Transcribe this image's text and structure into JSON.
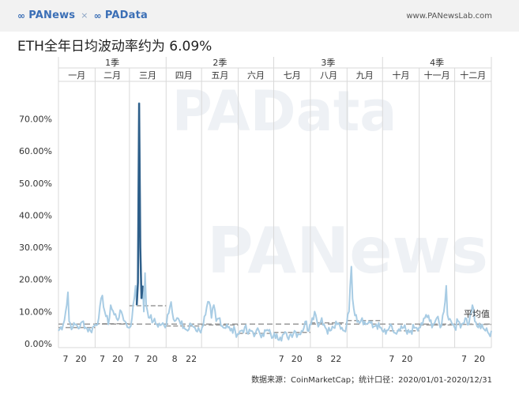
{
  "header": {
    "brand_left": "PANews",
    "brand_sep": "×",
    "brand_right": "PAData",
    "site": "www.PANewsLab.com"
  },
  "title": "ETH全年日均波动率约为 6.09%",
  "source": "数据来源：CoinMarketCap；统计口径：2020/01/01-2020/12/31",
  "watermarks": [
    "PAData",
    "PANews"
  ],
  "colors": {
    "series": "#a8cce4",
    "series_peak": "#2e5f8a",
    "avg_line": "#999999",
    "grid": "#d9d9d9"
  },
  "chart_data": {
    "type": "line",
    "quarters": [
      "1季",
      "2季",
      "3季",
      "4季"
    ],
    "months": [
      "一月",
      "二月",
      "三月",
      "四月",
      "五月",
      "六月",
      "七月",
      "八月",
      "九月",
      "十月",
      "十一月",
      "十二月"
    ],
    "month_days": [
      31,
      29,
      31,
      30,
      31,
      30,
      31,
      31,
      30,
      31,
      30,
      31
    ],
    "x_ticks": [
      {
        "label": "7",
        "day": 7
      },
      {
        "label": "20",
        "day": 20
      },
      {
        "label": "7",
        "day": 38
      },
      {
        "label": "20",
        "day": 51
      },
      {
        "label": "7",
        "day": 67
      },
      {
        "label": "20",
        "day": 80
      },
      {
        "label": "8",
        "day": 99
      },
      {
        "label": "22",
        "day": 113
      },
      {
        "label": "7",
        "day": 189
      },
      {
        "label": "20",
        "day": 202
      },
      {
        "label": "8",
        "day": 221
      },
      {
        "label": "22",
        "day": 235
      },
      {
        "label": "7",
        "day": 282
      },
      {
        "label": "20",
        "day": 295
      },
      {
        "label": "7",
        "day": 343
      },
      {
        "label": "20",
        "day": 356
      }
    ],
    "y_ticks": [
      "0.00%",
      "10.00%",
      "20.00%",
      "30.00%",
      "40.00%",
      "50.00%",
      "60.00%",
      "70.00%"
    ],
    "ylim": [
      0,
      0.78
    ],
    "y_tick_values": [
      0,
      0.1,
      0.2,
      0.3,
      0.4,
      0.5,
      0.6,
      0.7
    ],
    "avg_label": "平均值",
    "annual_average": 0.0609,
    "monthly_averages": [
      0.05,
      0.062,
      0.118,
      0.055,
      0.058,
      0.032,
      0.035,
      0.065,
      0.072,
      0.04,
      0.058,
      0.06
    ],
    "anchors": [
      [
        1,
        0.04
      ],
      [
        5,
        0.06
      ],
      [
        8,
        0.12
      ],
      [
        9,
        0.16
      ],
      [
        10,
        0.07
      ],
      [
        13,
        0.05
      ],
      [
        16,
        0.06
      ],
      [
        19,
        0.05
      ],
      [
        22,
        0.07
      ],
      [
        24,
        0.05
      ],
      [
        28,
        0.04
      ],
      [
        32,
        0.06
      ],
      [
        35,
        0.08
      ],
      [
        38,
        0.15
      ],
      [
        40,
        0.1
      ],
      [
        43,
        0.06
      ],
      [
        45,
        0.12
      ],
      [
        48,
        0.09
      ],
      [
        52,
        0.08
      ],
      [
        54,
        0.1
      ],
      [
        57,
        0.07
      ],
      [
        60,
        0.05
      ],
      [
        61,
        0.05
      ],
      [
        63,
        0.08
      ],
      [
        66,
        0.18
      ],
      [
        67,
        0.12
      ],
      [
        68,
        0.19
      ],
      [
        69,
        0.75
      ],
      [
        70,
        0.3
      ],
      [
        71,
        0.14
      ],
      [
        72,
        0.18
      ],
      [
        73,
        0.1
      ],
      [
        74,
        0.22
      ],
      [
        75,
        0.12
      ],
      [
        78,
        0.08
      ],
      [
        81,
        0.07
      ],
      [
        84,
        0.06
      ],
      [
        88,
        0.06
      ],
      [
        91,
        0.05
      ],
      [
        93,
        0.09
      ],
      [
        96,
        0.13
      ],
      [
        99,
        0.07
      ],
      [
        101,
        0.08
      ],
      [
        104,
        0.06
      ],
      [
        107,
        0.05
      ],
      [
        110,
        0.04
      ],
      [
        113,
        0.06
      ],
      [
        116,
        0.05
      ],
      [
        120,
        0.04
      ],
      [
        122,
        0.05
      ],
      [
        125,
        0.09
      ],
      [
        128,
        0.13
      ],
      [
        130,
        0.08
      ],
      [
        132,
        0.12
      ],
      [
        134,
        0.07
      ],
      [
        137,
        0.08
      ],
      [
        140,
        0.05
      ],
      [
        143,
        0.06
      ],
      [
        146,
        0.04
      ],
      [
        150,
        0.04
      ],
      [
        152,
        0.03
      ],
      [
        155,
        0.04
      ],
      [
        158,
        0.05
      ],
      [
        161,
        0.03
      ],
      [
        164,
        0.04
      ],
      [
        167,
        0.03
      ],
      [
        170,
        0.04
      ],
      [
        173,
        0.03
      ],
      [
        176,
        0.04
      ],
      [
        180,
        0.03
      ],
      [
        182,
        0.02
      ],
      [
        185,
        0.03
      ],
      [
        188,
        0.02
      ],
      [
        191,
        0.03
      ],
      [
        194,
        0.02
      ],
      [
        197,
        0.03
      ],
      [
        200,
        0.04
      ],
      [
        203,
        0.03
      ],
      [
        206,
        0.04
      ],
      [
        208,
        0.05
      ],
      [
        210,
        0.07
      ],
      [
        211,
        0.04
      ],
      [
        213,
        0.06
      ],
      [
        215,
        0.08
      ],
      [
        217,
        0.1
      ],
      [
        219,
        0.07
      ],
      [
        221,
        0.06
      ],
      [
        223,
        0.08
      ],
      [
        226,
        0.05
      ],
      [
        230,
        0.04
      ],
      [
        233,
        0.05
      ],
      [
        236,
        0.06
      ],
      [
        240,
        0.05
      ],
      [
        242,
        0.04
      ],
      [
        244,
        0.06
      ],
      [
        246,
        0.1
      ],
      [
        247,
        0.18
      ],
      [
        248,
        0.24
      ],
      [
        249,
        0.14
      ],
      [
        250,
        0.11
      ],
      [
        252,
        0.09
      ],
      [
        254,
        0.07
      ],
      [
        257,
        0.08
      ],
      [
        260,
        0.06
      ],
      [
        263,
        0.07
      ],
      [
        266,
        0.05
      ],
      [
        269,
        0.06
      ],
      [
        272,
        0.05
      ],
      [
        274,
        0.04
      ],
      [
        277,
        0.03
      ],
      [
        280,
        0.05
      ],
      [
        283,
        0.04
      ],
      [
        286,
        0.03
      ],
      [
        289,
        0.04
      ],
      [
        292,
        0.05
      ],
      [
        295,
        0.03
      ],
      [
        298,
        0.04
      ],
      [
        302,
        0.05
      ],
      [
        304,
        0.04
      ],
      [
        305,
        0.05
      ],
      [
        308,
        0.06
      ],
      [
        311,
        0.09
      ],
      [
        314,
        0.07
      ],
      [
        317,
        0.06
      ],
      [
        320,
        0.08
      ],
      [
        323,
        0.05
      ],
      [
        326,
        0.1
      ],
      [
        328,
        0.18
      ],
      [
        329,
        0.09
      ],
      [
        332,
        0.07
      ],
      [
        334,
        0.06
      ],
      [
        335,
        0.05
      ],
      [
        338,
        0.07
      ],
      [
        341,
        0.06
      ],
      [
        344,
        0.08
      ],
      [
        347,
        0.06
      ],
      [
        350,
        0.12
      ],
      [
        352,
        0.07
      ],
      [
        355,
        0.05
      ],
      [
        358,
        0.06
      ],
      [
        361,
        0.04
      ],
      [
        364,
        0.03
      ],
      [
        366,
        0.04
      ]
    ]
  }
}
